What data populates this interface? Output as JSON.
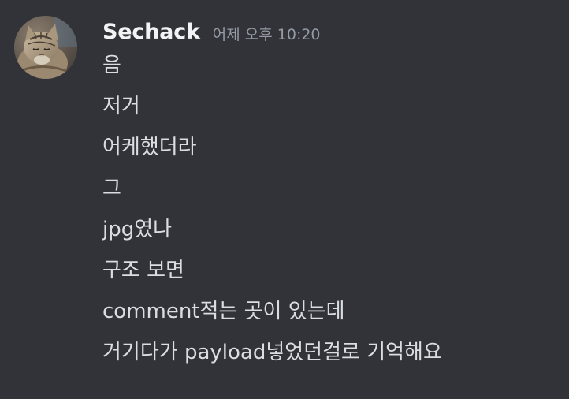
{
  "author": {
    "username": "Sechack",
    "timestamp": "어제 오후 10:20",
    "avatar_icon": "tabby-cat-avatar"
  },
  "messages": [
    "음",
    "저거",
    "어케했더라",
    "그",
    "jpg였나",
    "구조 보면",
    "comment적는 곳이 있는데",
    "거기다가 payload넣었던걸로 기억해요"
  ],
  "colors": {
    "background": "#313338",
    "username": "#f2f3f5",
    "timestamp": "#949ba4",
    "message_text": "#dbdee1"
  }
}
